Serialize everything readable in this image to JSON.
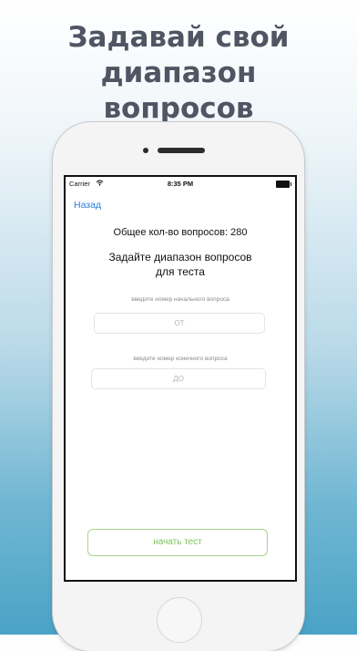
{
  "headline": {
    "line1": "Задавай свой диапазон",
    "line2": "вопросов"
  },
  "status_bar": {
    "carrier": "Carrier",
    "time": "8:35 PM"
  },
  "nav": {
    "back_label": "Назад"
  },
  "content": {
    "total_questions": "Общее кол-во вопросов: 280",
    "prompt_line1": "Задайте диапазон вопросов",
    "prompt_line2": "для теста",
    "start_hint": "введите номер начального вопроса",
    "start_placeholder": "ОТ",
    "end_hint": "введите номер конечного вопроса",
    "end_placeholder": "ДО",
    "start_button": "начать тест"
  },
  "icons": [
    "wifi-icon",
    "battery-icon"
  ],
  "colors": {
    "accent_blue": "#2a7de1",
    "button_green": "#7cc35a",
    "headline": "#4f5562"
  }
}
